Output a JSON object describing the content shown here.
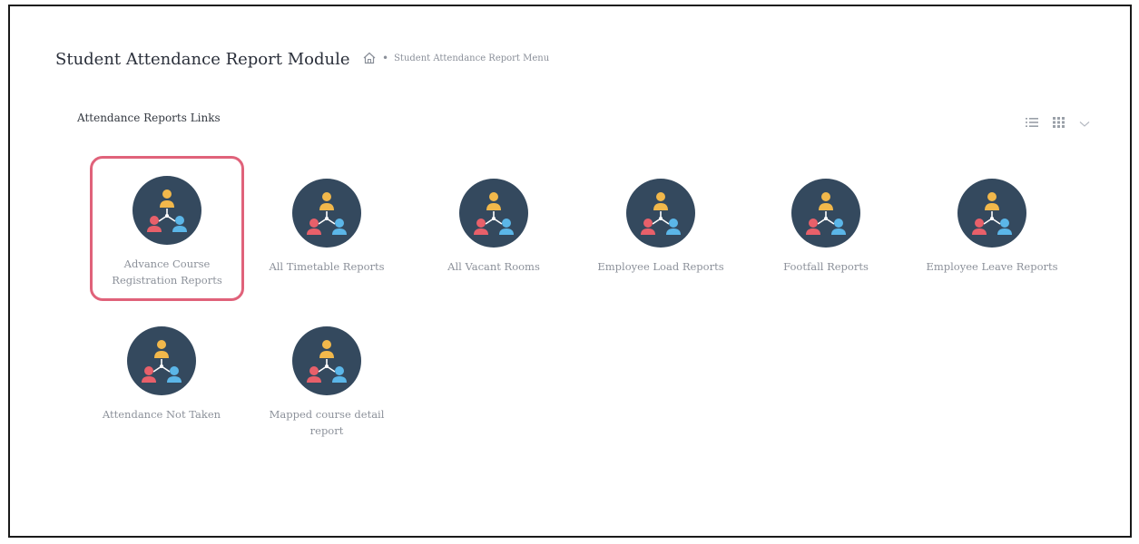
{
  "header": {
    "title": "Student Attendance Report Module",
    "breadcrumb": {
      "home_icon": "home-icon",
      "separator": "•",
      "current": "Student Attendance Report Menu"
    }
  },
  "section": {
    "title": "Attendance Reports Links"
  },
  "view_controls": {
    "icons": [
      "list-view-icon",
      "grid-view-icon",
      "chevron-down-icon"
    ]
  },
  "tiles": [
    {
      "label": "Advance Course Registration Reports",
      "icon": "org-hierarchy-icon",
      "selected": true
    },
    {
      "label": "All Timetable Reports",
      "icon": "org-hierarchy-icon",
      "selected": false
    },
    {
      "label": "All Vacant Rooms",
      "icon": "org-hierarchy-icon",
      "selected": false
    },
    {
      "label": "Employee Load Reports",
      "icon": "org-hierarchy-icon",
      "selected": false
    },
    {
      "label": "Footfall Reports",
      "icon": "org-hierarchy-icon",
      "selected": false
    },
    {
      "label": "Employee Leave Reports",
      "icon": "org-hierarchy-icon",
      "selected": false
    },
    {
      "label": "Attendance Not Taken",
      "icon": "org-hierarchy-icon",
      "selected": false
    },
    {
      "label": "Mapped course detail report",
      "icon": "org-hierarchy-icon",
      "selected": false
    }
  ],
  "colors": {
    "icon_circle": "#34495e",
    "icon_top_person": "#f2b84b",
    "icon_left_person": "#e8606a",
    "icon_right_person": "#5bb6e8",
    "selected_border": "#e0627a"
  }
}
